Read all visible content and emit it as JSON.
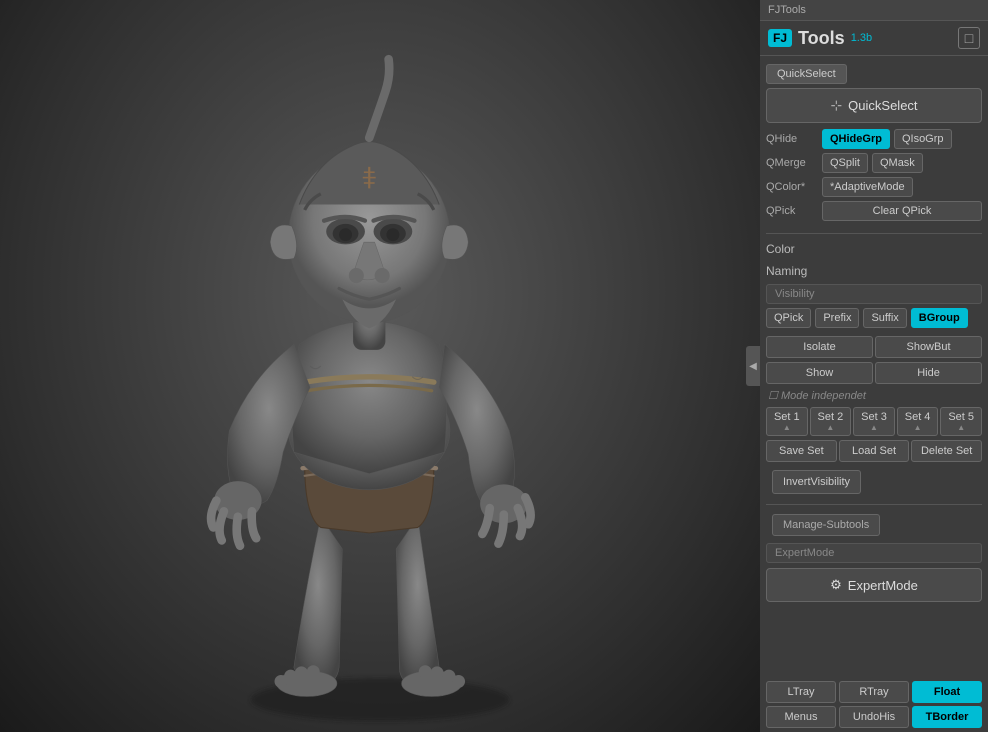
{
  "titlebar": {
    "text": "FJTools"
  },
  "header": {
    "fj_badge": "FJ",
    "title": "Tools",
    "version": "1.3b",
    "icon": "□"
  },
  "quick_select": {
    "tab_label": "QuickSelect",
    "big_button_label": "QuickSelect",
    "q_hide_label": "QHide",
    "q_hide_btn1": "QHideGrp",
    "q_hide_btn2": "QIsoGrp",
    "q_merge_label": "QMerge",
    "q_merge_btn1": "QSplit",
    "q_merge_btn2": "QMask",
    "q_color_label": "QColor*",
    "q_color_btn1": "*AdaptiveMode",
    "q_pick_label": "QPick",
    "q_pick_btn1": "Clear QPick"
  },
  "color_section": {
    "label": "Color"
  },
  "naming_section": {
    "label": "Naming"
  },
  "visibility_section": {
    "bar_label": "Visibility",
    "q_pick_label": "QPick",
    "prefix_label": "Prefix",
    "suffix_label": "Suffix",
    "bgroup_label": "BGroup",
    "isolate_label": "Isolate",
    "showbut_label": "ShowBut",
    "show_label": "Show",
    "hide_label": "Hide",
    "mode_independent": "Mode independet",
    "set1": "Set 1",
    "set2": "Set 2",
    "set3": "Set 3",
    "set4": "Set 4",
    "set5": "Set 5",
    "save_set": "Save Set",
    "load_set": "Load Set",
    "delete_set": "Delete Set",
    "invert_visibility": "InvertVisibility"
  },
  "manage_subtools": {
    "label": "Manage-Subtools",
    "expert_mode_bar": "ExpertMode",
    "expert_mode_btn": "ExpertMode"
  },
  "bottom_toolbar": {
    "ltray": "LTray",
    "rtray": "RTray",
    "float": "Float",
    "menus": "Menus",
    "undohis": "UndoHis",
    "tborder": "TBorder"
  }
}
